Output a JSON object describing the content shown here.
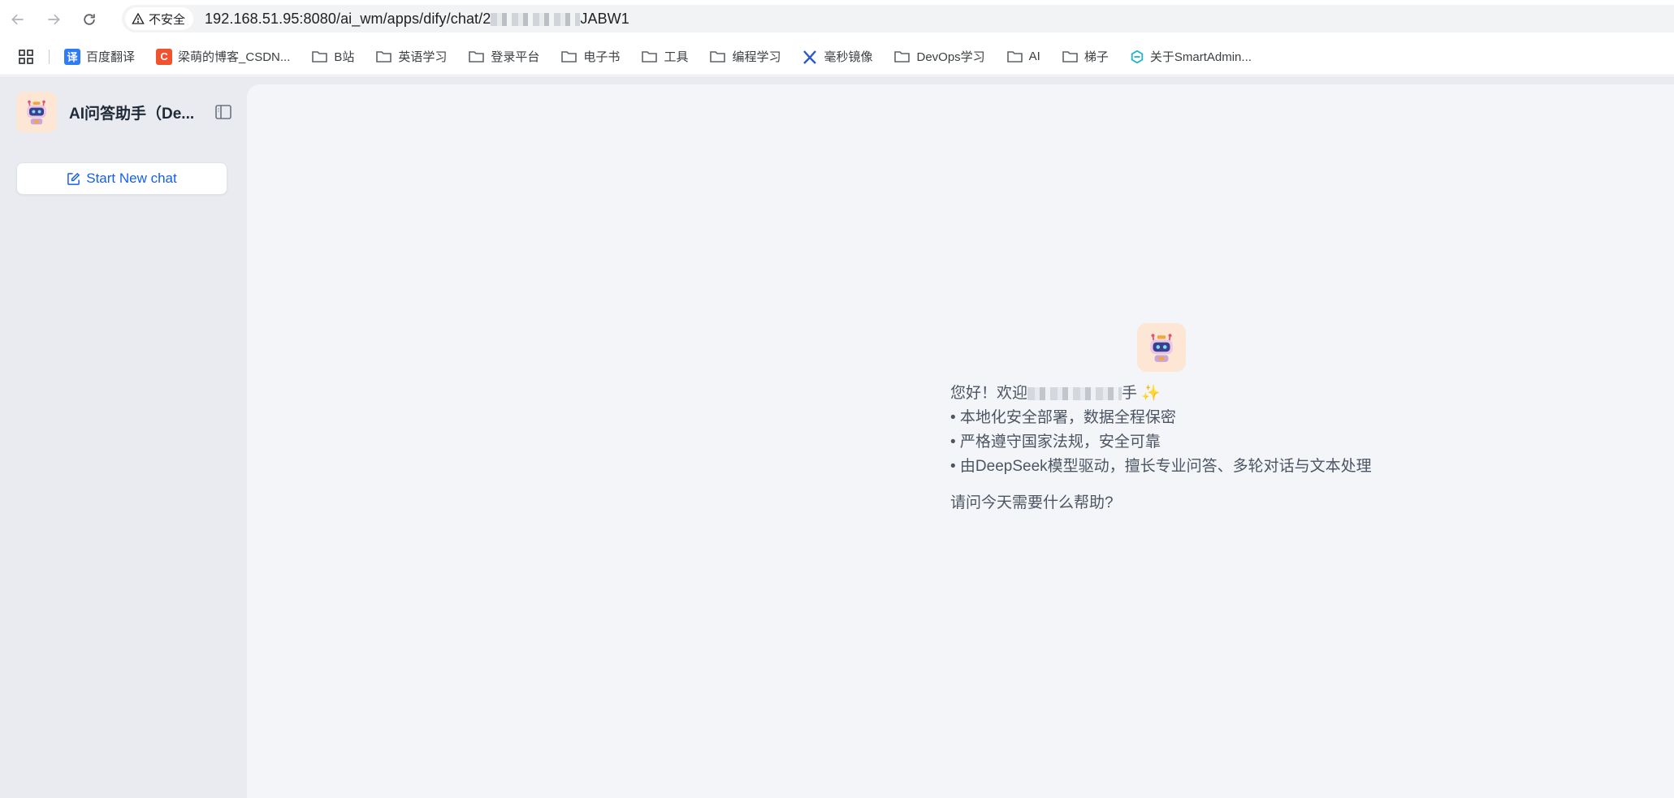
{
  "browser": {
    "security_label": "不安全",
    "url_prefix": "192.168.51.95:8080/ai_wm/apps/dify/chat/2",
    "url_suffix": "JABW1"
  },
  "bookmarks": [
    {
      "label": "百度翻译",
      "icon": "baidu-translate-icon",
      "color": "#2f7cf6",
      "glyph": "译"
    },
    {
      "label": "梁萌的博客_CSDN...",
      "icon": "csdn-icon",
      "color": "#f0532d",
      "glyph": "C"
    },
    {
      "label": "B站",
      "icon": "folder-icon"
    },
    {
      "label": "英语学习",
      "icon": "folder-icon"
    },
    {
      "label": "登录平台",
      "icon": "folder-icon"
    },
    {
      "label": "电子书",
      "icon": "folder-icon"
    },
    {
      "label": "工具",
      "icon": "folder-icon"
    },
    {
      "label": "编程学习",
      "icon": "folder-icon"
    },
    {
      "label": "毫秒镜像",
      "icon": "mirror-icon",
      "color": "#2b59c3"
    },
    {
      "label": "DevOps学习",
      "icon": "folder-icon"
    },
    {
      "label": "AI",
      "icon": "folder-icon"
    },
    {
      "label": "梯子",
      "icon": "folder-icon"
    },
    {
      "label": "关于SmartAdmin...",
      "icon": "smartadmin-icon",
      "color": "#1fb6c9"
    }
  ],
  "sidebar": {
    "app_name": "AI问答助手（De...",
    "new_chat_label": "Start New chat"
  },
  "welcome": {
    "greeting_prefix": "您好！欢迎",
    "greeting_suffix": "手 ✨",
    "bullets": [
      "• 本地化安全部署，数据全程保密",
      "• 严格遵守国家法规，安全可靠",
      "• 由DeepSeek模型驱动，擅长专业问答、多轮对话与文本处理"
    ],
    "question": "请问今天需要什么帮助?"
  },
  "colors": {
    "accent": "#155eef",
    "sidebar_bg": "#e9ebf0",
    "main_bg": "#f4f5f8",
    "avatar_bg": "#fde6d3"
  }
}
